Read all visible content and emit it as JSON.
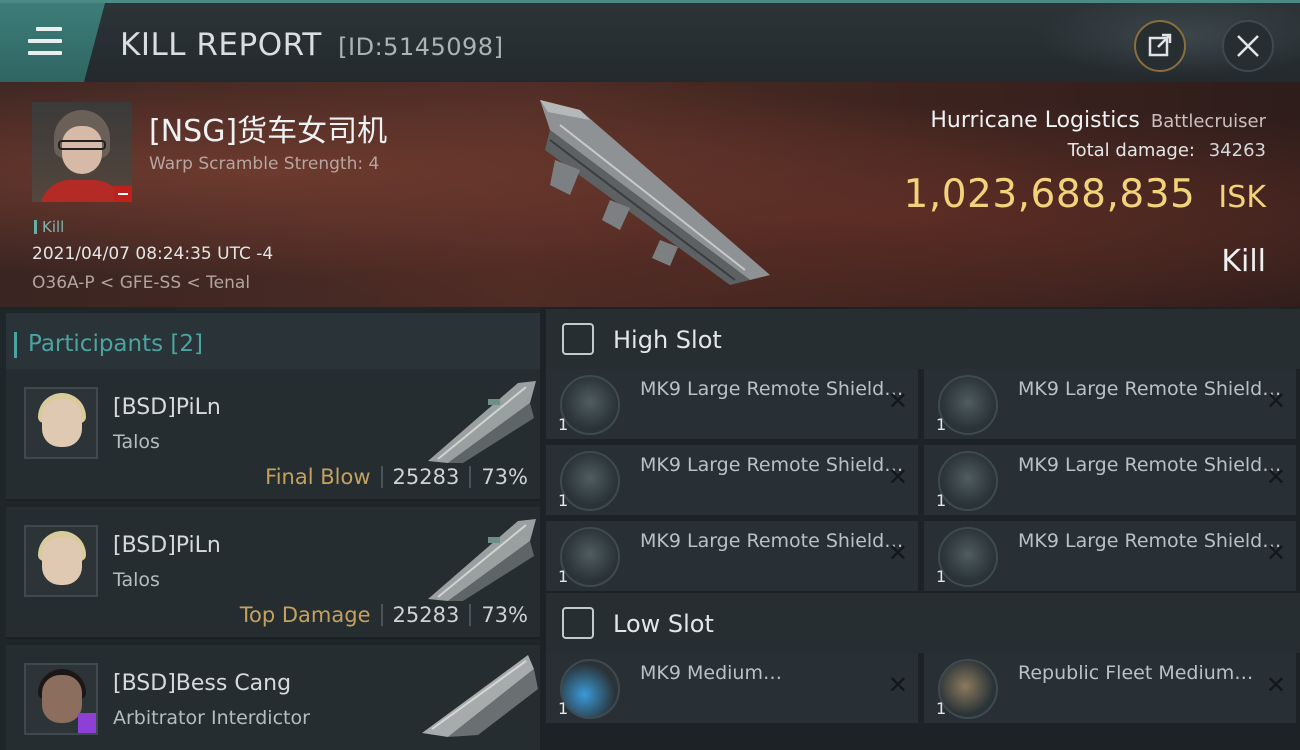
{
  "header": {
    "title": "KILL REPORT",
    "report_id": "[ID:5145098]",
    "share_icon": "share-icon",
    "close_icon": "close-icon"
  },
  "victim": {
    "name": "[NSG]货车女司机",
    "warp_scramble": "Warp Scramble Strength: 4",
    "tag": "Kill",
    "time": "2021/04/07 08:24:35 UTC -4",
    "location": "O36A-P < GFE-SS < Tenal",
    "ship_name": "Hurricane Logistics",
    "ship_class": "Battlecruiser",
    "total_damage_label": "Total damage:",
    "total_damage": "34263",
    "isk_value": "1,023,688,835",
    "isk_unit": "ISK",
    "result": "Kill"
  },
  "participants": {
    "label": "Participants [2]",
    "items": [
      {
        "name": "[BSD]PiLn",
        "ship": "Talos",
        "tag": "Final Blow",
        "damage": "25283",
        "percent": "73%"
      },
      {
        "name": "[BSD]PiLn",
        "ship": "Talos",
        "tag": "Top Damage",
        "damage": "25283",
        "percent": "73%"
      },
      {
        "name": "[BSD]Bess Cang",
        "ship": "Arbitrator Interdictor"
      }
    ]
  },
  "slots": {
    "high_label": "High Slot",
    "low_label": "Low Slot",
    "high": [
      {
        "name": "MK9 Large Remote Shield…",
        "qty": "1"
      },
      {
        "name": "MK9 Large Remote Shield…",
        "qty": "1"
      },
      {
        "name": "MK9 Large Remote Shield…",
        "qty": "1"
      },
      {
        "name": "MK9 Large Remote Shield…",
        "qty": "1"
      },
      {
        "name": "MK9 Large Remote Shield…",
        "qty": "1"
      },
      {
        "name": "MK9 Large Remote Shield…",
        "qty": "1"
      }
    ],
    "low": [
      {
        "name": "MK9 Medium…",
        "qty": "1"
      },
      {
        "name": "Republic Fleet Medium…",
        "qty": "1"
      }
    ],
    "remove_glyph": "✕"
  },
  "colors": {
    "accent": "#4aa4a2",
    "isk": "#f2d27a",
    "tag_gold": "#c4a25e"
  }
}
